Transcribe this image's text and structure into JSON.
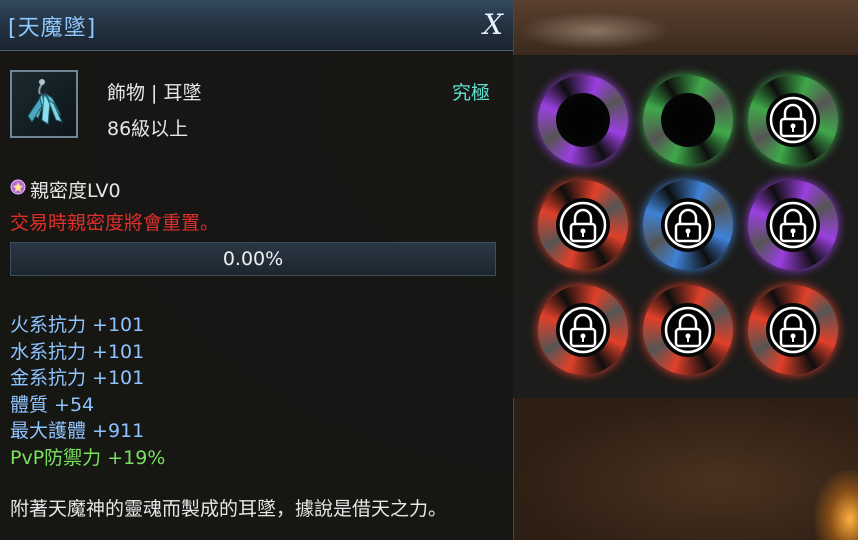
{
  "window": {
    "title": "[天魔墜]",
    "close_label": "X"
  },
  "item": {
    "icon": "earring-icon",
    "category": "飾物 | 耳墜",
    "level_req": "86級以上",
    "grade": "究極"
  },
  "intimacy": {
    "icon": "intimacy-gem-icon",
    "label": "親密度LV0",
    "warning": "交易時親密度將會重置。",
    "progress_text": "0.00%",
    "progress_value": 0.0
  },
  "stats": [
    "火系抗力 +101",
    "水系抗力 +101",
    "金系抗力 +101",
    "體質 +54",
    "最大護體 +911"
  ],
  "pvp_stat": "PvP防禦力 +19%",
  "description": "附著天魔神的靈魂而製成的耳墜，據說是借天之力。",
  "sockets": [
    {
      "color": "#9a3fe0",
      "state": "open"
    },
    {
      "color": "#3fa84a",
      "state": "open"
    },
    {
      "color": "#3fa84a",
      "state": "locked"
    },
    {
      "color": "#e0402a",
      "state": "locked"
    },
    {
      "color": "#3f82d8",
      "state": "locked"
    },
    {
      "color": "#9a3fe0",
      "state": "locked"
    },
    {
      "color": "#e0402a",
      "state": "locked"
    },
    {
      "color": "#e0402a",
      "state": "locked"
    },
    {
      "color": "#e0402a",
      "state": "locked"
    }
  ],
  "colors": {
    "title": "#8ec8ff",
    "grade": "#5ee0d0",
    "warning": "#e0302a",
    "stat": "#8fc4ff",
    "pvp": "#7ae060"
  }
}
